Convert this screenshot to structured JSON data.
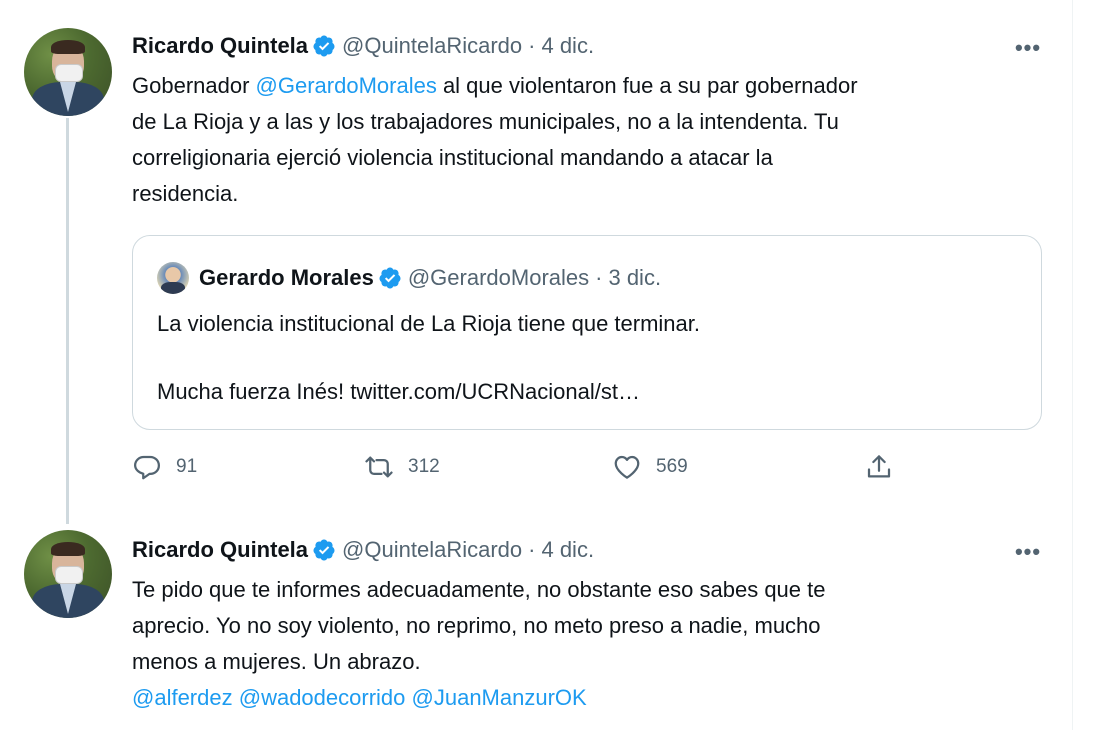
{
  "tweets": [
    {
      "author": {
        "name": "Ricardo Quintela",
        "handle": "@QuintelaRicardo",
        "verified": true,
        "avatar": "profile-photo-man-with-mask"
      },
      "separator": "·",
      "date": "4 dic.",
      "more_icon": "more-horizontal-icon",
      "more_label": "•••",
      "text": {
        "line1_pre": "Gobernador ",
        "line1_mention": "@GerardoMorales",
        "line1_post": " al que violentaron fue a su par gobernador",
        "line2": "de La Rioja y a las y los trabajadores municipales, no a la intendenta. Tu",
        "line3": "correligionaria ejerció violencia institucional mandando a atacar la",
        "line4": "residencia."
      },
      "quote": {
        "author_name": "Gerardo Morales",
        "author_handle": "@GerardoMorales",
        "verified": true,
        "separator": "·",
        "date": "3 dic.",
        "line1": "La violencia institucional de La Rioja tiene que terminar.",
        "line2": "Mucha fuerza Inés! twitter.com/UCRNacional/st…"
      },
      "actions": {
        "reply": {
          "icon": "reply-icon",
          "count": "91"
        },
        "retweet": {
          "icon": "retweet-icon",
          "count": "312"
        },
        "like": {
          "icon": "heart-icon",
          "count": "569"
        },
        "share": {
          "icon": "share-icon"
        }
      }
    },
    {
      "author": {
        "name": "Ricardo Quintela",
        "handle": "@QuintelaRicardo",
        "verified": true,
        "avatar": "profile-photo-man-with-mask"
      },
      "separator": "·",
      "date": "4 dic.",
      "more_icon": "more-horizontal-icon",
      "more_label": "•••",
      "text": {
        "line1": "Te pido que te informes adecuadamente, no obstante eso sabes que te",
        "line2": "aprecio. Yo no soy violento, no reprimo, no meto preso a nadie, mucho",
        "line3": "menos a mujeres. Un abrazo.",
        "mention1": "@alferdez",
        "mention2": "@wadodecorrido",
        "mention3": "@JuanManzurOK"
      }
    }
  ],
  "colors": {
    "accent": "#1d9bf0",
    "text_primary": "#0f1419",
    "text_secondary": "#536471",
    "border": "#cfd9de"
  }
}
